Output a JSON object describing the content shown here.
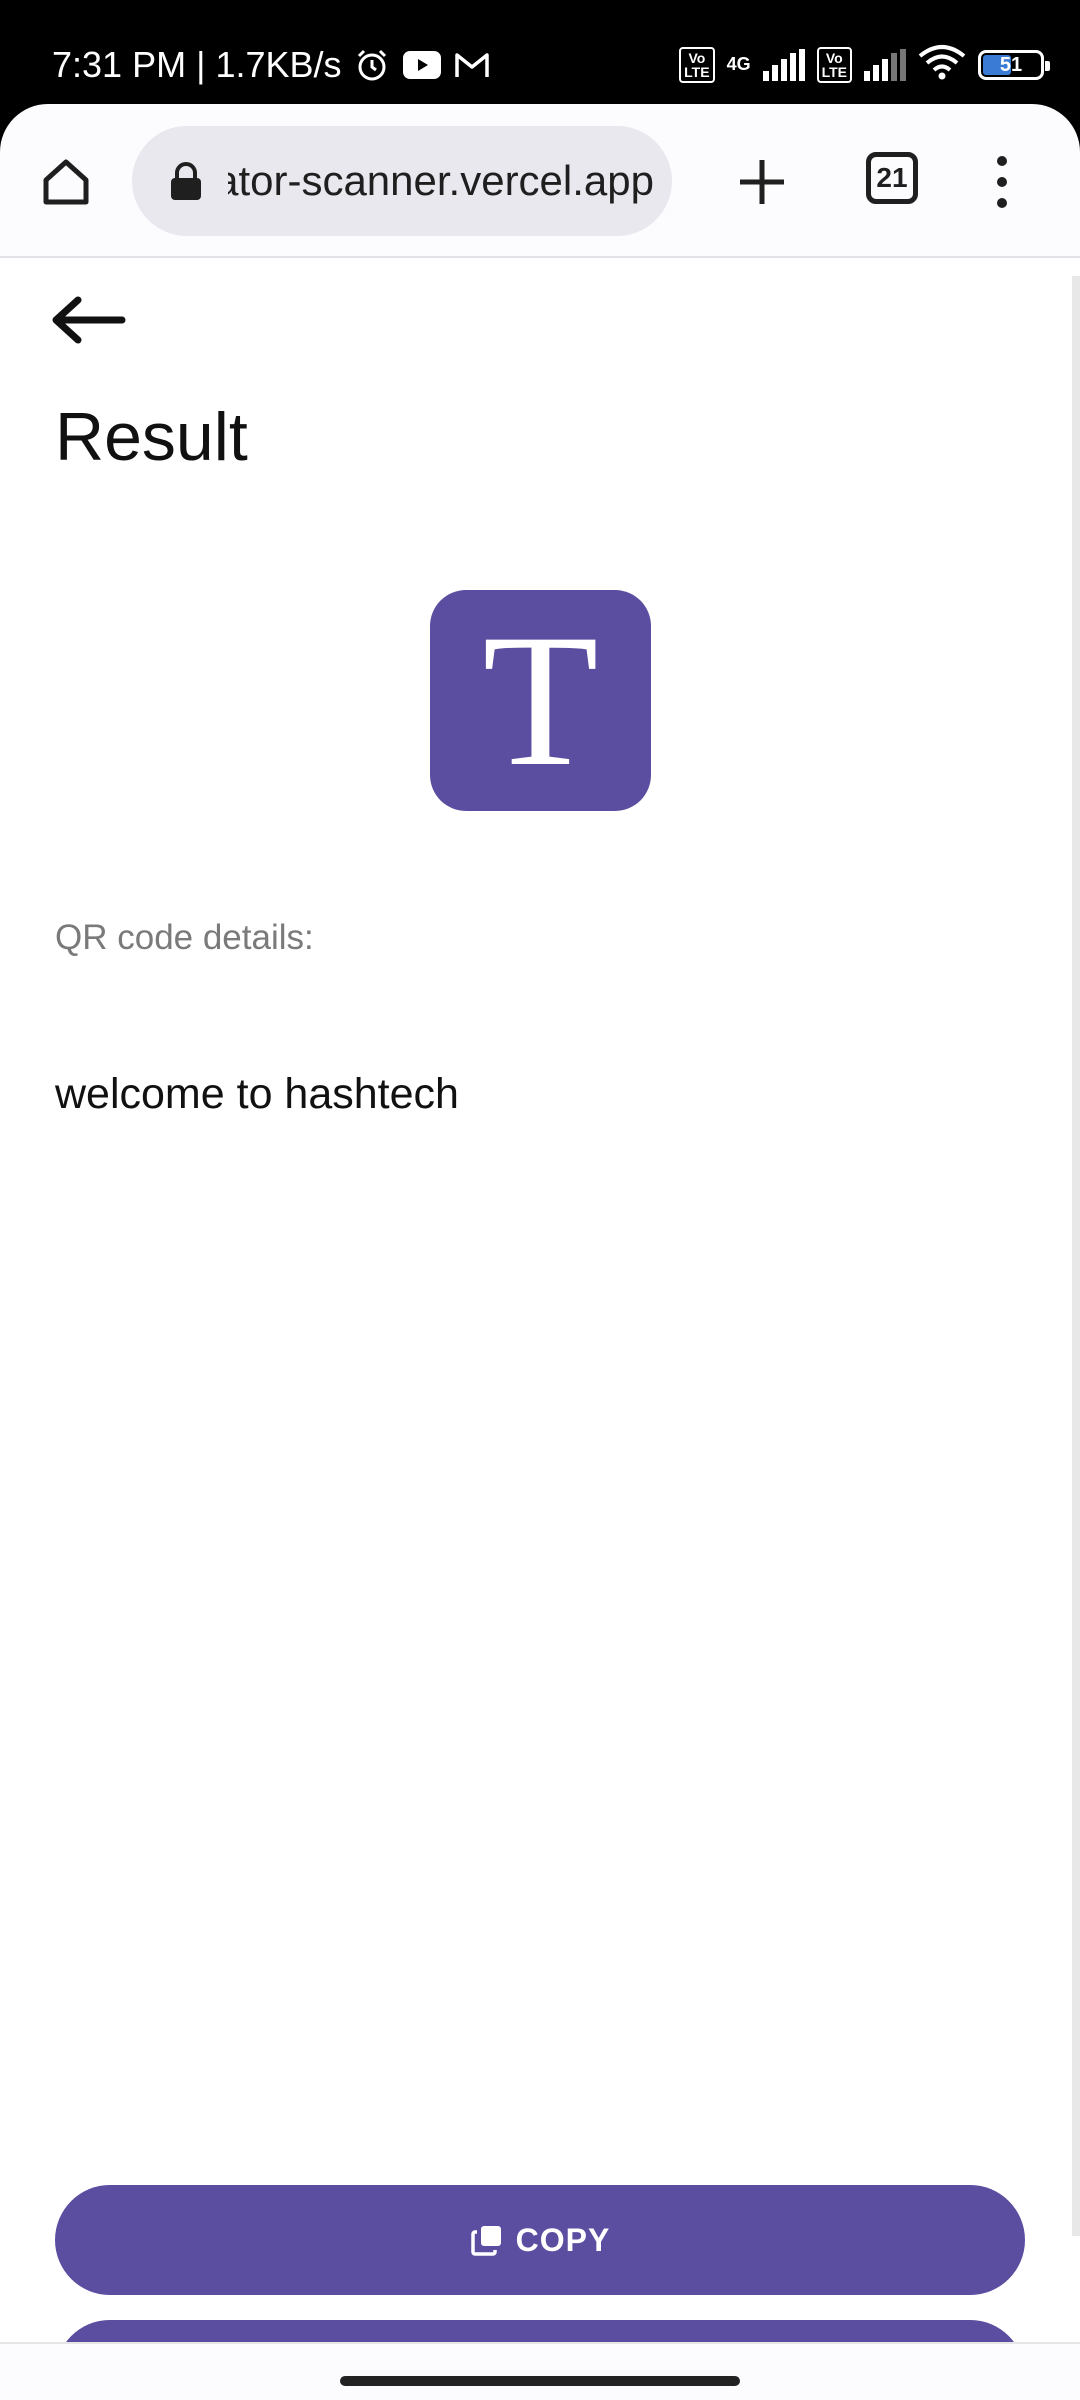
{
  "status_bar": {
    "time": "7:31 PM",
    "separator": "|",
    "speed": "1.7KB/s",
    "icons_left": [
      "alarm-icon",
      "youtube-icon",
      "gmail-icon"
    ],
    "volte_1": "Vo\nLTE",
    "network_type": "4G",
    "volte_2": "Vo\nLTE",
    "battery_level": "51",
    "battery_fraction": 0.51
  },
  "browser": {
    "url": "qr-generator-scanner.vercel.app",
    "tab_count": "21",
    "icons": [
      "home-icon",
      "lock-icon",
      "plus-icon",
      "tabs-icon",
      "more-vert-icon"
    ]
  },
  "page": {
    "title": "Result",
    "logo_letter": "T",
    "details_label": "QR code details:",
    "details_value": "welcome to hashtech",
    "copy_label": "COPY"
  },
  "colors": {
    "accent": "#5b4ea0",
    "status_bar_bg": "#000000",
    "url_box_bg": "#e9e8ef",
    "muted_text": "#7a7a7a"
  }
}
